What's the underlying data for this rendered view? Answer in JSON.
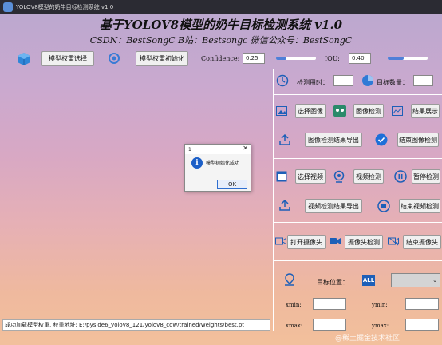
{
  "window": {
    "title": "YOLOV8模型的奶牛目标检测系统 v1.0"
  },
  "header": {
    "title": "基于YOLOV8模型的奶牛目标检测系统 v1.0",
    "subtitle": "CSDN：BestSongC   B站：Bestsongc   微信公众号：BestSongC"
  },
  "toolbar": {
    "select_weights": "模型权重选择",
    "init_weights": "模型权重初始化",
    "confidence_label": "Confidence:",
    "confidence_value": "0.25",
    "confidence_level": 0.25,
    "iou_label": "IOU:",
    "iou_value": "0.40",
    "iou_level": 0.4
  },
  "panel": {
    "time_label": "检测用时：",
    "time_value": "",
    "count_label": "目标数量：",
    "count_value": "",
    "select_image": "选择图像",
    "image_detect": "图像检测",
    "show_result": "结果展示",
    "export_image": "图像检测结果导出",
    "stop_image": "结束图像检测",
    "select_video": "选择视频",
    "video_detect": "视频检测",
    "pause_detect": "暂停检测",
    "export_video": "视频检测结果导出",
    "stop_video": "结束视频检测",
    "open_camera": "打开摄像头",
    "camera_detect": "摄像头检测",
    "close_camera": "结束摄像头",
    "target_pos_label": "目标位置：",
    "target_select": "",
    "all_icon_text": "ALL",
    "xmin_label": "xmin:",
    "ymin_label": "ymin:",
    "xmax_label": "xmax:",
    "ymax_label": "ymax:"
  },
  "status": {
    "text": "成功加载模型权重, 权重地址: E:/pyside6_yolov8_121/yolov8_cow/trained/weights/best.pt"
  },
  "dialog": {
    "title": "1",
    "message": "模型初始化成功",
    "ok": "OK"
  },
  "watermark": "@稀土掘金技术社区"
}
